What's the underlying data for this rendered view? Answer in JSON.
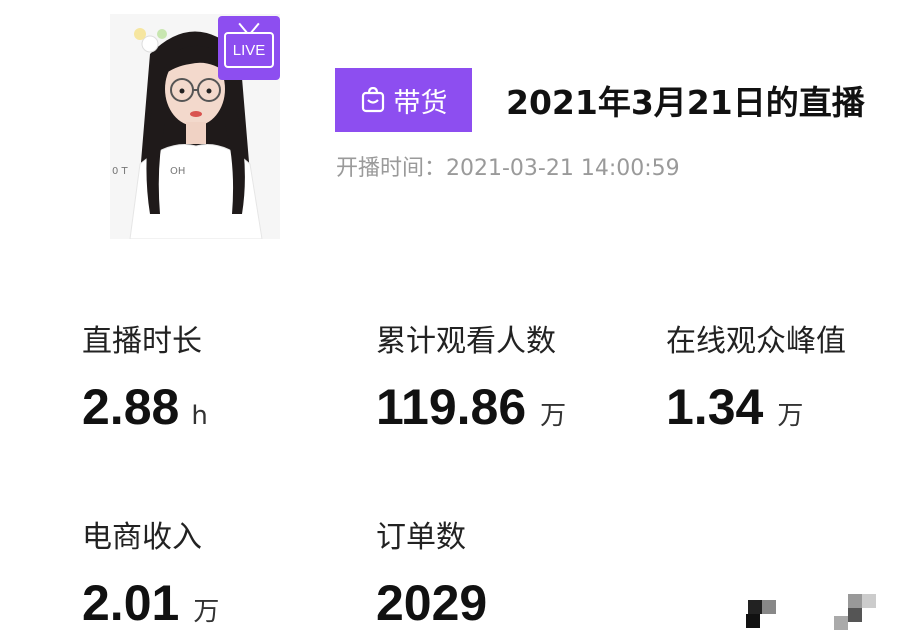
{
  "header": {
    "live_badge": "LIVE",
    "goods_tag": "带货",
    "title": "2021年3月21日的直播",
    "start_time": "开播时间：2021-03-21 14:00:59"
  },
  "icons": {
    "live_badge_icon": "tv-icon",
    "goods_tag_icon": "shopping-bag-icon"
  },
  "colors": {
    "accent": "#8d4ef0",
    "muted_text": "#9a9a9a"
  },
  "stats": [
    {
      "label": "直播时长",
      "value": "2.88",
      "unit": "h"
    },
    {
      "label": "累计观看人数",
      "value": "119.86",
      "unit": "万"
    },
    {
      "label": "在线观众峰值",
      "value": "1.34",
      "unit": "万"
    },
    {
      "label": "电商收入",
      "value": "2.01",
      "unit": "万"
    },
    {
      "label": "订单数",
      "value": "2029",
      "unit": ""
    }
  ]
}
